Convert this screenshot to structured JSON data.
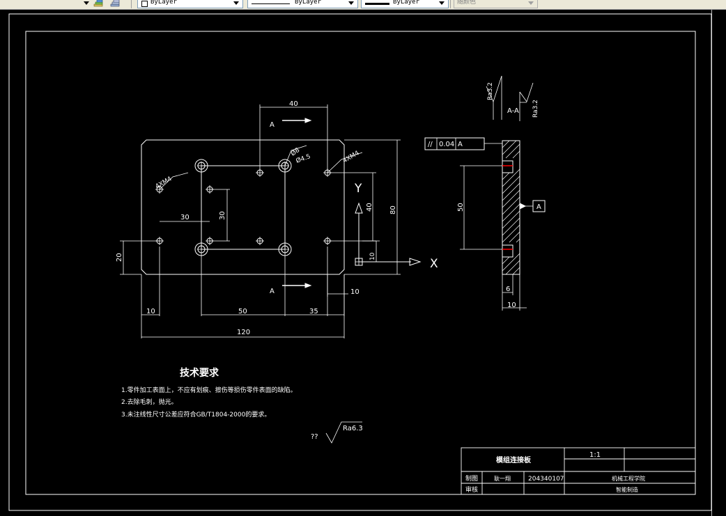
{
  "toolbar": {
    "layer_combo": "ByLayer",
    "linetype_combo": "ByLayer",
    "lineweight_combo": "ByLayer",
    "plotstyle_combo": "随颜色"
  },
  "drawing": {
    "dimensions": {
      "top_40": "40",
      "hole_dia_8": "Ø8",
      "hole_dia_4_5": "Ø4.5",
      "thread_left": "4XM4",
      "thread_right": "4XM4",
      "height_80": "80",
      "height_40": "40",
      "inner_30_v": "30",
      "inner_30_h": "30",
      "left_20": "20",
      "y_offset_10": "10",
      "right_10": "10",
      "bottom_10": "10",
      "bottom_50": "50",
      "bottom_35": "35",
      "bottom_120": "120"
    },
    "section_labels": {
      "top_a": "A",
      "bottom_a": "A",
      "section_title": "A-A"
    },
    "axes": {
      "x": "X",
      "y": "Y"
    },
    "section_view": {
      "rough_left": "Ra3.2",
      "rough_right": "Ra3.2",
      "tolerance_symbol": "//",
      "tolerance_value": "0.04",
      "tolerance_datum": "A",
      "datum_label": "A",
      "dim_50": "50",
      "dim_6": "6",
      "dim_10": "10"
    },
    "tech_requirements": {
      "title": "技术要求",
      "items": [
        "1.零件加工表面上，不应有划痕、擦伤等损伤零件表面的缺陷。",
        "2.去除毛刺，抛光。",
        "3.未注线性尺寸公差应符合GB/T1804-2000的要求。"
      ],
      "rough_prefix": "??",
      "rough_symbol": "Ra6.3"
    },
    "title_block": {
      "part_name": "模组连接板",
      "scale": "1:1",
      "drawn_label": "制图",
      "drawn_name": "耿一翔",
      "student_id": "204340107",
      "school": "机械工程学院",
      "checked_label": "审核",
      "class_name": "智能制造"
    }
  },
  "colors": {
    "canvas": "#000000",
    "line": "#ffffff",
    "hole_red": "#ff0000",
    "toolbar": "#ece9d8"
  }
}
